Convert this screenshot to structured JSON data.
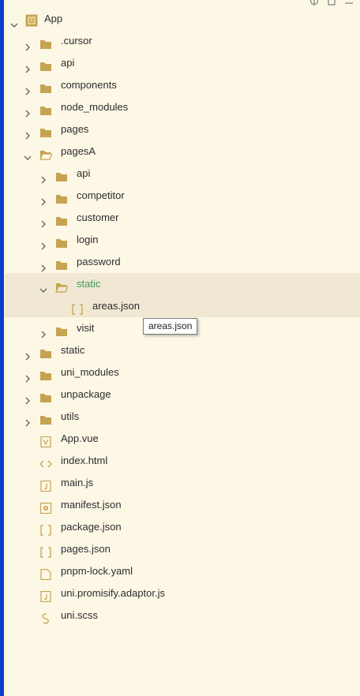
{
  "root": {
    "label": "App"
  },
  "tree": [
    {
      "label": ".cursor",
      "type": "folder",
      "expanded": false
    },
    {
      "label": "api",
      "type": "folder",
      "expanded": false
    },
    {
      "label": "components",
      "type": "folder",
      "expanded": false
    },
    {
      "label": "node_modules",
      "type": "folder",
      "expanded": false
    },
    {
      "label": "pages",
      "type": "folder",
      "expanded": false
    },
    {
      "label": "pagesA",
      "type": "folder",
      "expanded": true,
      "children": [
        {
          "label": "api",
          "type": "folder",
          "expanded": false
        },
        {
          "label": "competitor",
          "type": "folder",
          "expanded": false
        },
        {
          "label": "customer",
          "type": "folder",
          "expanded": false
        },
        {
          "label": "login",
          "type": "folder",
          "expanded": false
        },
        {
          "label": "password",
          "type": "folder",
          "expanded": false
        },
        {
          "label": "static",
          "type": "folder",
          "expanded": true,
          "highlighted": true,
          "children": [
            {
              "label": "areas.json",
              "type": "json"
            }
          ]
        },
        {
          "label": "visit",
          "type": "folder",
          "expanded": false
        }
      ]
    },
    {
      "label": "static",
      "type": "folder",
      "expanded": false
    },
    {
      "label": "uni_modules",
      "type": "folder",
      "expanded": false
    },
    {
      "label": "unpackage",
      "type": "folder",
      "expanded": false
    },
    {
      "label": "utils",
      "type": "folder",
      "expanded": false
    },
    {
      "label": "App.vue",
      "type": "vue"
    },
    {
      "label": "index.html",
      "type": "html"
    },
    {
      "label": "main.js",
      "type": "js"
    },
    {
      "label": "manifest.json",
      "type": "manifest"
    },
    {
      "label": "package.json",
      "type": "json"
    },
    {
      "label": "pages.json",
      "type": "json"
    },
    {
      "label": "pnpm-lock.yaml",
      "type": "yaml"
    },
    {
      "label": "uni.promisify.adaptor.js",
      "type": "js"
    },
    {
      "label": "uni.scss",
      "type": "scss"
    }
  ],
  "tooltip": {
    "text": "areas.json"
  },
  "colors": {
    "background": "#fdf7e6",
    "folder": "#c6a352",
    "highlight_row": "#f0e8d2",
    "highlight_text": "#3a9b54",
    "left_bar": "#0d3ec9"
  }
}
